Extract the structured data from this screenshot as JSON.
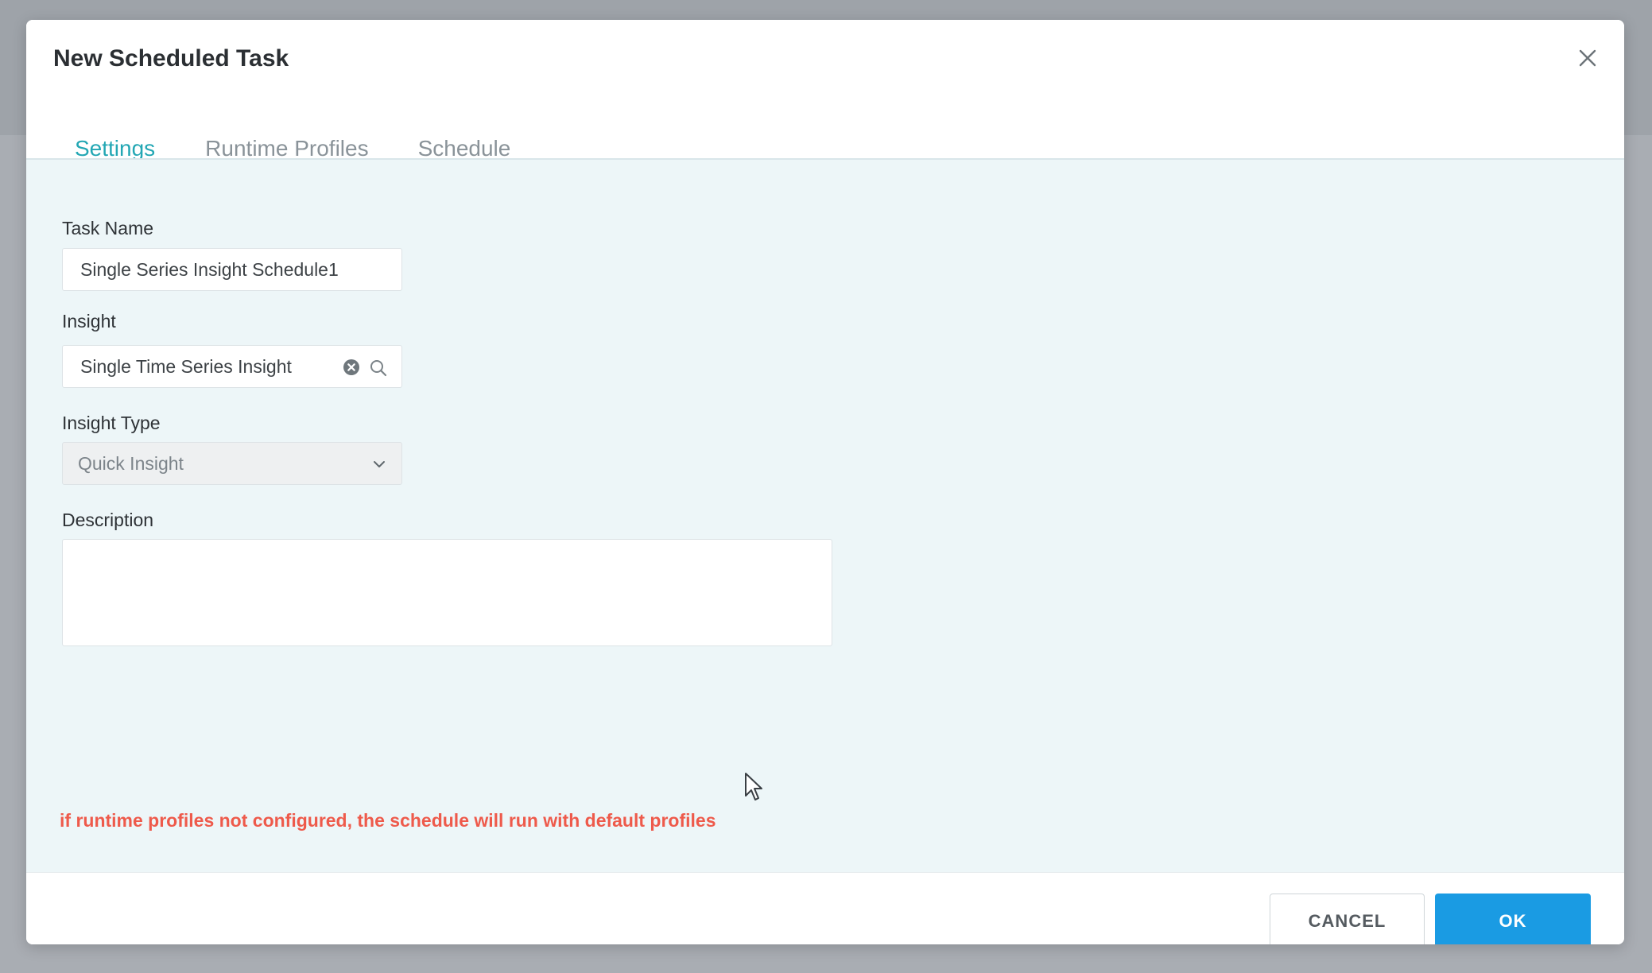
{
  "dialog": {
    "title": "New Scheduled Task"
  },
  "tabs": [
    {
      "label": "Settings",
      "active": true
    },
    {
      "label": "Runtime Profiles",
      "active": false
    },
    {
      "label": "Schedule",
      "active": false
    }
  ],
  "form": {
    "task_name": {
      "label": "Task Name",
      "value": "Single Series Insight Schedule1"
    },
    "insight": {
      "label": "Insight",
      "value": "Single Time Series Insight"
    },
    "insight_type": {
      "label": "Insight Type",
      "value": "Quick Insight"
    },
    "description": {
      "label": "Description",
      "value": ""
    }
  },
  "warning": "if runtime profiles not configured, the schedule will run with default profiles",
  "footer": {
    "cancel_label": "CANCEL",
    "ok_label": "OK"
  },
  "icons": {
    "close": "close-icon",
    "clear": "clear-circle-icon",
    "search": "search-icon",
    "dropdown": "chevron-down-icon"
  },
  "colors": {
    "accent": "#23a7b4",
    "primary_button": "#1a9be3",
    "warning": "#ee5a4b",
    "body_background": "#edf6f8"
  }
}
